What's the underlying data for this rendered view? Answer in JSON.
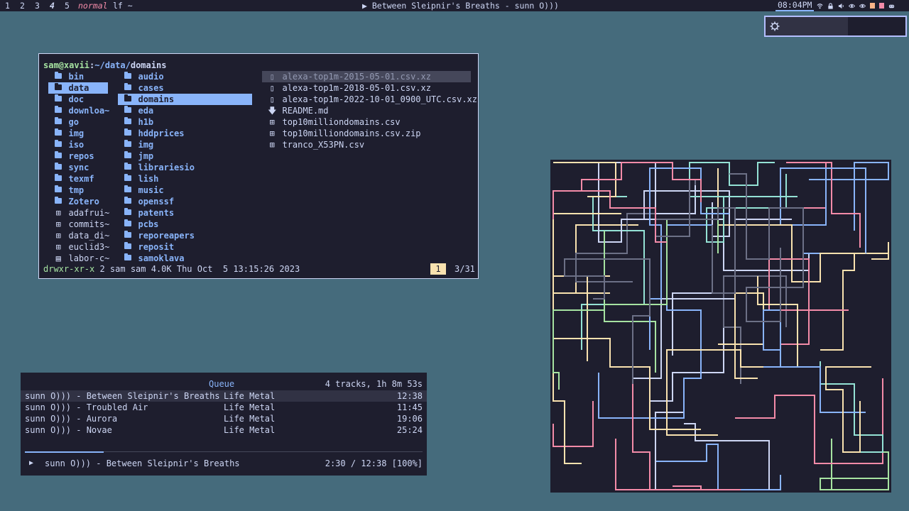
{
  "topbar": {
    "workspaces": [
      "1",
      "2",
      "3",
      "4",
      "5"
    ],
    "active_workspace": "4",
    "mode": "normal",
    "window_title": "lf ~",
    "now_playing": "▶ Between Sleipnir's Breaths - sunn O)))",
    "clock": "08:04PM",
    "tray_icons": [
      "wifi-icon",
      "lock-icon",
      "volume-icon",
      "eye-icon",
      "eye-icon",
      "battery-icon",
      "warning-icon",
      "gamepad-icon"
    ]
  },
  "popup": {
    "icon": "gear-icon",
    "level": 0.59
  },
  "lf": {
    "prompt_user": "sam@xavii",
    "prompt_sep": ":",
    "prompt_parent": "~/data/",
    "prompt_current": "domains",
    "col1": [
      {
        "name": "bin",
        "kind": "dir"
      },
      {
        "name": "data",
        "kind": "dir",
        "selected": true
      },
      {
        "name": "doc",
        "kind": "dir"
      },
      {
        "name": "downloa~",
        "kind": "dir"
      },
      {
        "name": "go",
        "kind": "dir"
      },
      {
        "name": "img",
        "kind": "dir"
      },
      {
        "name": "iso",
        "kind": "dir"
      },
      {
        "name": "repos",
        "kind": "dir"
      },
      {
        "name": "sync",
        "kind": "dir"
      },
      {
        "name": "texmf",
        "kind": "dir"
      },
      {
        "name": "tmp",
        "kind": "dir"
      },
      {
        "name": "Zotero",
        "kind": "dir"
      },
      {
        "name": "adafrui~",
        "kind": "grid"
      },
      {
        "name": "commits~",
        "kind": "grid"
      },
      {
        "name": "data_di~",
        "kind": "grid"
      },
      {
        "name": "euclid3~",
        "kind": "grid"
      },
      {
        "name": "labor-c~",
        "kind": "archive"
      }
    ],
    "col2": [
      {
        "name": "audio",
        "kind": "dir"
      },
      {
        "name": "cases",
        "kind": "dir"
      },
      {
        "name": "domains",
        "kind": "dir",
        "selected": true
      },
      {
        "name": "eda",
        "kind": "dir"
      },
      {
        "name": "h1b",
        "kind": "dir"
      },
      {
        "name": "hddprices",
        "kind": "dir"
      },
      {
        "name": "img",
        "kind": "dir"
      },
      {
        "name": "jmp",
        "kind": "dir"
      },
      {
        "name": "librariesio",
        "kind": "dir"
      },
      {
        "name": "lish",
        "kind": "dir"
      },
      {
        "name": "music",
        "kind": "dir"
      },
      {
        "name": "openssf",
        "kind": "dir"
      },
      {
        "name": "patents",
        "kind": "dir"
      },
      {
        "name": "pcbs",
        "kind": "dir"
      },
      {
        "name": "reporeapers",
        "kind": "dir"
      },
      {
        "name": "reposit",
        "kind": "dir"
      },
      {
        "name": "samoklava",
        "kind": "dir"
      }
    ],
    "col3": [
      {
        "name": "alexa-top1m-2015-05-01.csv.xz",
        "kind": "doc",
        "selected": true
      },
      {
        "name": "alexa-top1m-2018-05-01.csv.xz",
        "kind": "doc"
      },
      {
        "name": "alexa-top1m-2022-10-01_0900_UTC.csv.xz",
        "kind": "doc"
      },
      {
        "name": "README.md",
        "kind": "down"
      },
      {
        "name": "top10milliondomains.csv",
        "kind": "grid"
      },
      {
        "name": "top10milliondomains.csv.zip",
        "kind": "grid"
      },
      {
        "name": "tranco_X53PN.csv",
        "kind": "grid"
      }
    ],
    "status_perm": "drwxr-xr-x",
    "status_rest": " 2 sam sam 4.0K Thu Oct  5 13:15:26 2023",
    "badge": "1",
    "count": "3/31"
  },
  "music": {
    "queue_label": "Queue",
    "queue_stats": "4 tracks, 1h 8m 53s",
    "tracks": [
      {
        "title": "sunn O))) - Between Sleipnir's Breaths",
        "album": "Life Metal",
        "duration": "12:38",
        "current": true
      },
      {
        "title": "sunn O))) - Troubled Air",
        "album": "Life Metal",
        "duration": "11:45"
      },
      {
        "title": "sunn O))) - Aurora",
        "album": "Life Metal",
        "duration": "19:06"
      },
      {
        "title": "sunn O))) - Novae",
        "album": "Life Metal",
        "duration": "25:24"
      }
    ],
    "progress": 0.198,
    "play_icon": "▶",
    "now_playing": "sunn O))) - Between Sleipnir's Breaths",
    "time": "2:30 / 12:38 [100%]"
  },
  "colors": {
    "bg": "#456b7c",
    "panel": "#1e1e2e",
    "accent": "#89b4fa",
    "green": "#a6e3a1",
    "red": "#f38ba8",
    "yellow": "#f9e2af",
    "teal": "#94e2d5",
    "grey": "#6c7086"
  }
}
